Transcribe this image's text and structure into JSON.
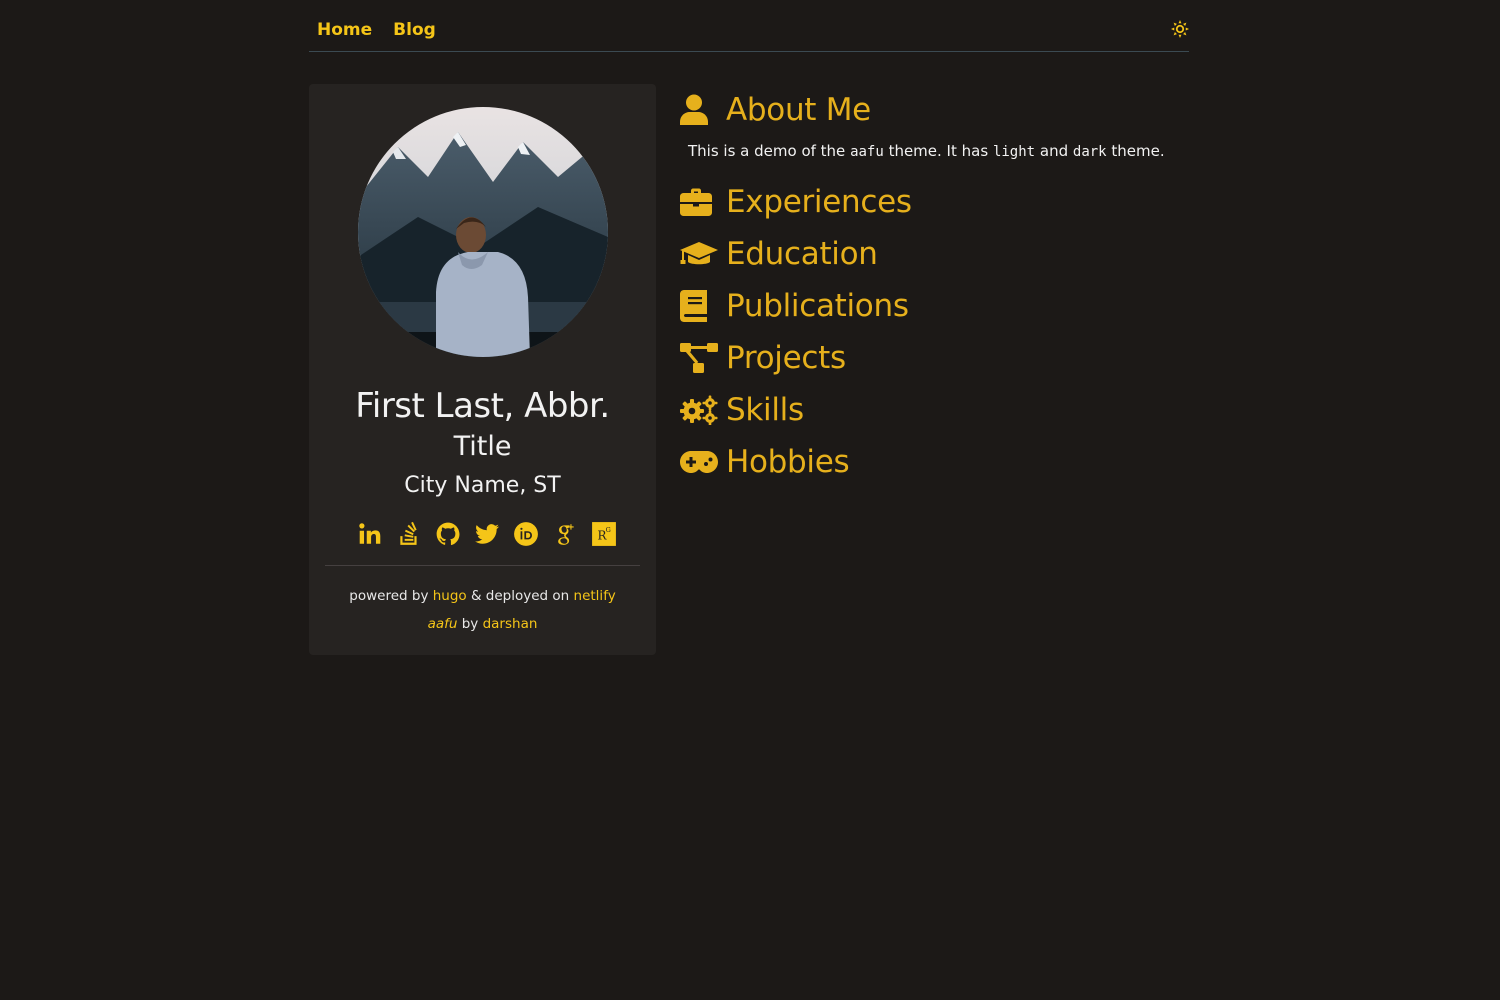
{
  "nav": {
    "links": [
      "Home",
      "Blog"
    ],
    "theme_toggle_icon": "sun-icon",
    "accent": "#f5c518"
  },
  "profile": {
    "name": "First Last, Abbr.",
    "title": "Title",
    "location": "City Name, ST",
    "socials": [
      "linkedin-icon",
      "stackoverflow-icon",
      "github-icon",
      "twitter-icon",
      "orcid-icon",
      "google-scholar-icon",
      "researchgate-icon"
    ],
    "footer": {
      "powered_by": "powered by",
      "hugo": "hugo",
      "deployed_on": "& deployed on",
      "netlify": "netlify",
      "aafu": "aafu",
      "by": "by",
      "darshan": "darshan"
    }
  },
  "about": {
    "heading": "About Me",
    "text_parts": [
      "This is a demo of the",
      "aafu",
      "theme. It has",
      "light",
      "and",
      "dark",
      "theme."
    ]
  },
  "sections": [
    {
      "label": "Experiences",
      "icon": "briefcase-icon"
    },
    {
      "label": "Education",
      "icon": "graduation-cap-icon"
    },
    {
      "label": "Publications",
      "icon": "book-icon"
    },
    {
      "label": "Projects",
      "icon": "project-diagram-icon"
    },
    {
      "label": "Skills",
      "icon": "cogs-icon"
    },
    {
      "label": "Hobbies",
      "icon": "gamepad-icon"
    }
  ],
  "colors": {
    "background": "#1c1917",
    "card": "#262321",
    "heading_accent": "#e6b01c"
  }
}
